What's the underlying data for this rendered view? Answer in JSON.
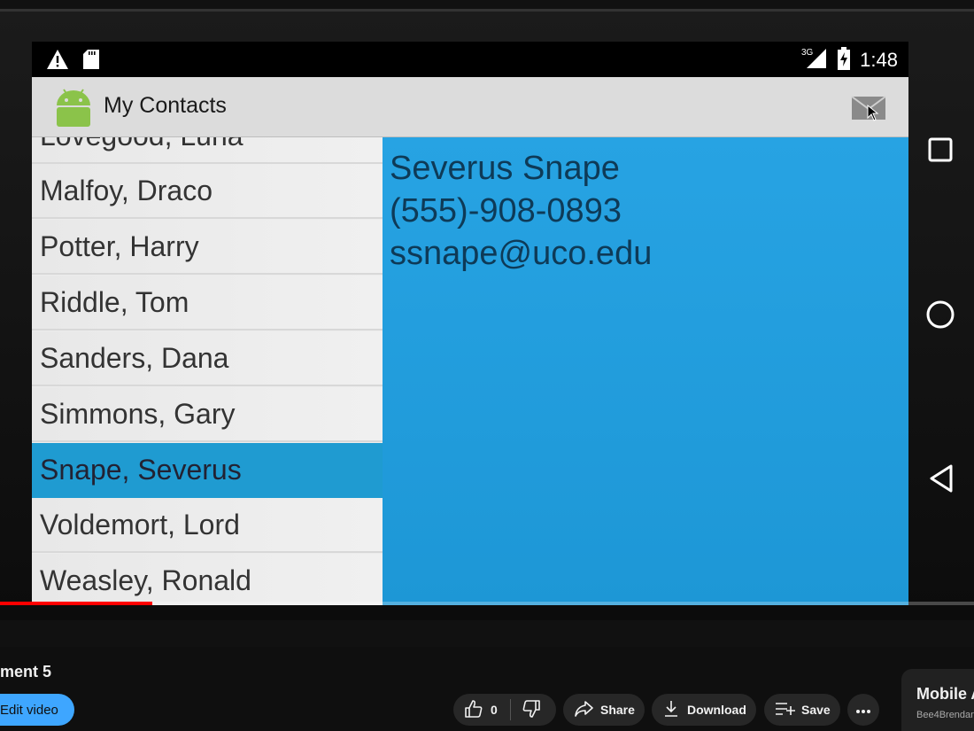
{
  "app": {
    "title": "My Contacts",
    "clock": "1:48",
    "network_label": "3G",
    "accent_color": "#1f9bd1"
  },
  "contacts": {
    "items": [
      "Lovegood, Luna",
      "Malfoy, Draco",
      "Potter, Harry",
      "Riddle, Tom",
      "Sanders, Dana",
      "Simmons, Gary",
      "Snape, Severus",
      "Voldemort, Lord",
      "Weasley, Ronald"
    ],
    "selected": "Snape, Severus"
  },
  "detail": {
    "name": "Severus Snape",
    "phone": "(555)-908-0893",
    "email": "ssnape@uco.edu"
  },
  "player": {
    "progress_fraction": 0.156
  },
  "video": {
    "title": "ment 5",
    "edit_label": "Edit video",
    "like_count": "0",
    "share_label": "Share",
    "download_label": "Download",
    "save_label": "Save"
  },
  "side_card": {
    "title": "Mobile A",
    "channel": "Bee4Brendan"
  },
  "icons": {
    "status_left": [
      "warning-icon",
      "sd-card-icon"
    ],
    "status_right": [
      "signal-icon",
      "battery-icon"
    ],
    "nav": [
      "recent-apps-icon",
      "home-icon",
      "back-icon"
    ],
    "actions": [
      "thumbs-up-icon",
      "thumbs-down-icon",
      "share-icon",
      "download-icon",
      "save-playlist-icon",
      "more-icon"
    ]
  }
}
